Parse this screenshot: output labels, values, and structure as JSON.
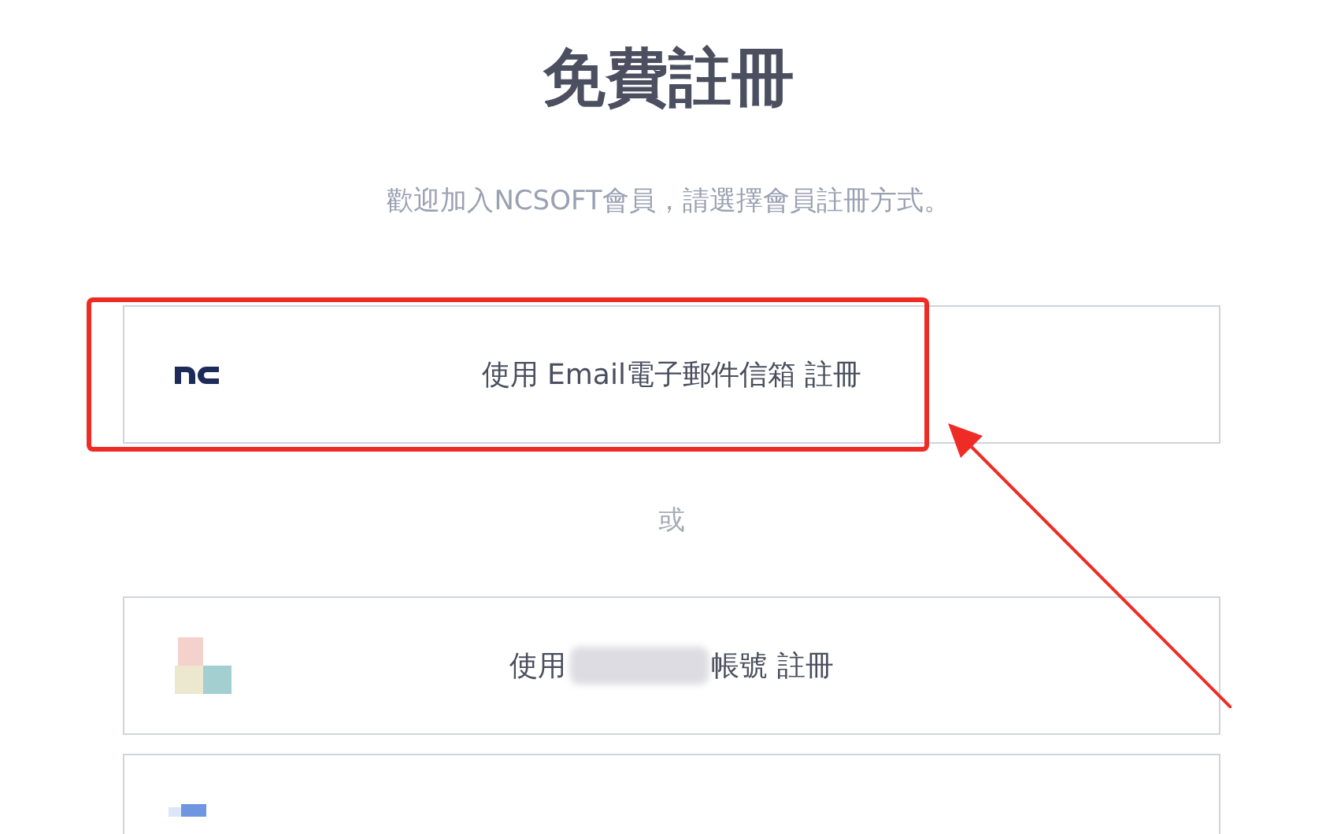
{
  "title": "免費註冊",
  "subtitle": "歡迎加入NCSOFT會員，請選擇會員註冊方式。",
  "options": [
    {
      "kind": "email",
      "label": "使用 Email電子郵件信箱 註冊",
      "highlighted": true
    },
    {
      "kind": "blurred",
      "label_before": "使用",
      "label_after": "帳號 註冊",
      "highlighted": false
    },
    {
      "kind": "cut",
      "highlighted": false
    }
  ],
  "separator": "或"
}
